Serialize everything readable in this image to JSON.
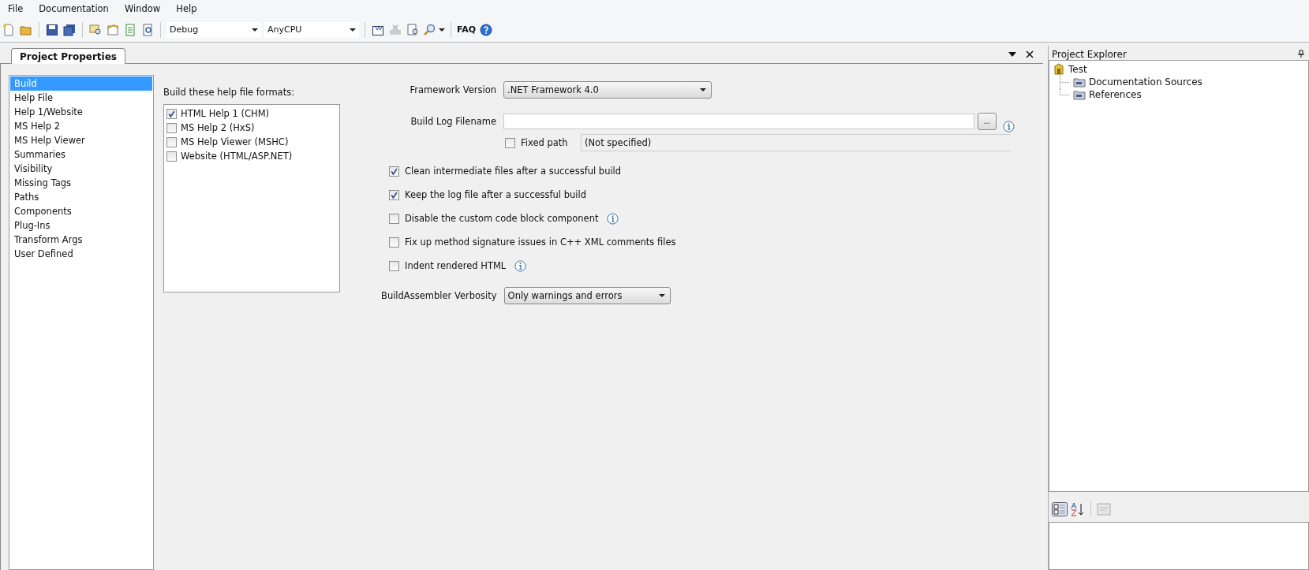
{
  "menu": [
    {
      "label": "File"
    },
    {
      "label": "Documentation"
    },
    {
      "label": "Window"
    },
    {
      "label": "Help"
    }
  ],
  "toolbar": {
    "configuration": "Debug",
    "platform": "AnyCPU",
    "faq": "FAQ"
  },
  "document_tab": {
    "title": "Project Properties"
  },
  "categories": [
    {
      "label": "Build",
      "selected": true
    },
    {
      "label": "Help File",
      "selected": false
    },
    {
      "label": "Help 1/Website",
      "selected": false
    },
    {
      "label": "MS Help 2",
      "selected": false
    },
    {
      "label": "MS Help Viewer",
      "selected": false
    },
    {
      "label": "Summaries",
      "selected": false
    },
    {
      "label": "Visibility",
      "selected": false
    },
    {
      "label": "Missing Tags",
      "selected": false
    },
    {
      "label": "Paths",
      "selected": false
    },
    {
      "label": "Components",
      "selected": false
    },
    {
      "label": "Plug-Ins",
      "selected": false
    },
    {
      "label": "Transform Args",
      "selected": false
    },
    {
      "label": "User Defined",
      "selected": false
    }
  ],
  "formats": {
    "label": "Build these help file formats:",
    "items": [
      {
        "label": "HTML Help 1 (CHM)",
        "checked": true
      },
      {
        "label": "MS Help 2 (HxS)",
        "checked": false
      },
      {
        "label": "MS Help Viewer (MSHC)",
        "checked": false
      },
      {
        "label": "Website (HTML/ASP.NET)",
        "checked": false
      }
    ]
  },
  "framework_version": {
    "label": "Framework Version",
    "value": ".NET Framework 4.0"
  },
  "build_log": {
    "label": "Build Log Filename",
    "browse": "...",
    "fixed_path": {
      "label": "Fixed path",
      "checked": false
    },
    "resolved": "(Not specified)"
  },
  "options": [
    {
      "label": "Clean intermediate files after a successful build",
      "checked": true,
      "info": false
    },
    {
      "label": "Keep the log file after a successful build",
      "checked": true,
      "info": false
    },
    {
      "label": "Disable the custom code block component",
      "checked": false,
      "info": true
    },
    {
      "label": "Fix up method signature issues in C++ XML comments files",
      "checked": false,
      "info": false
    },
    {
      "label": "Indent rendered HTML",
      "checked": false,
      "info": true
    }
  ],
  "verbosity": {
    "label": "BuildAssembler Verbosity",
    "value": "Only warnings and errors"
  },
  "project_explorer": {
    "title": "Project Explorer",
    "tree": [
      {
        "label": "Test",
        "expanded": true,
        "children": [
          {
            "label": "Documentation Sources"
          },
          {
            "label": "References"
          }
        ]
      }
    ]
  }
}
